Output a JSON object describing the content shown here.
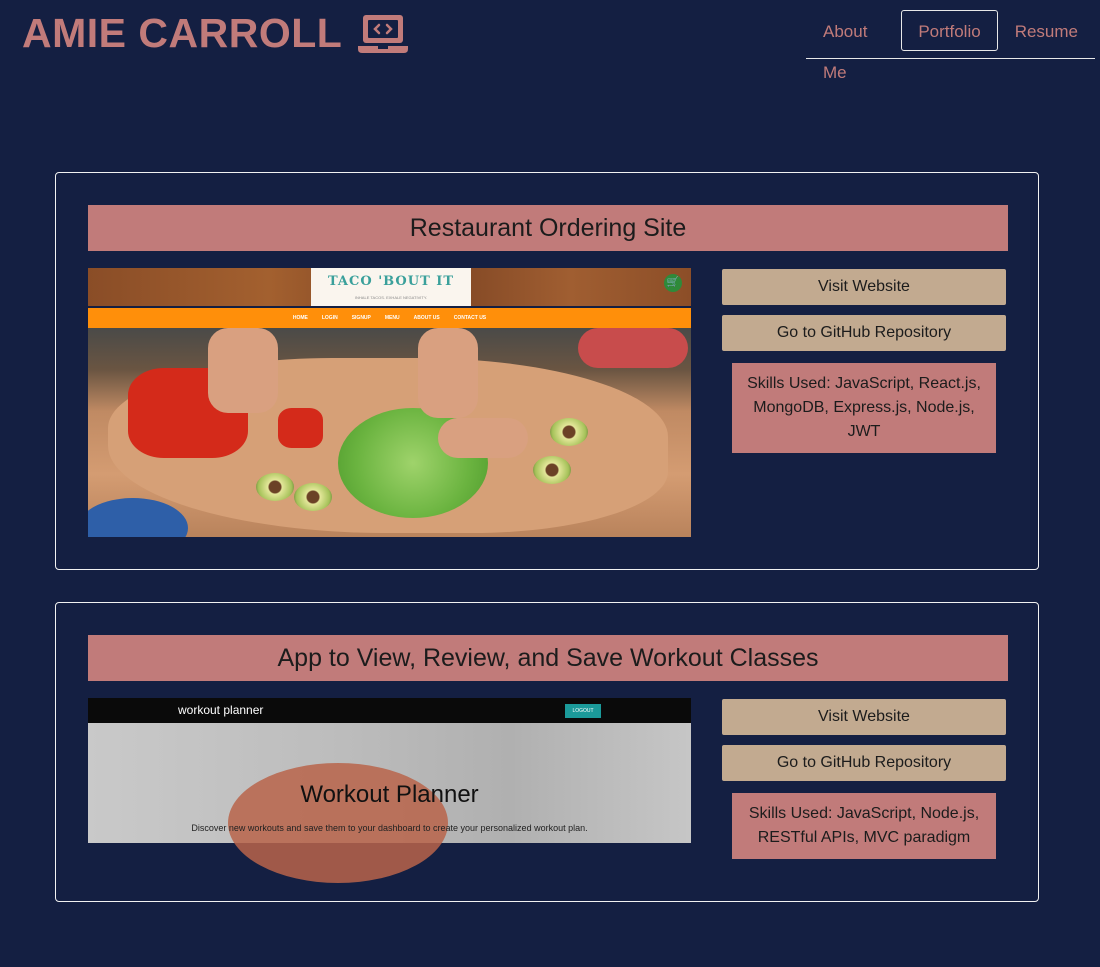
{
  "header": {
    "brand": "AMIE CARROLL",
    "brand_icon": "laptop-code-icon",
    "nav": [
      {
        "label": "About Me",
        "active": false
      },
      {
        "label": "Portfolio",
        "active": true
      },
      {
        "label": "Resume",
        "active": false
      }
    ]
  },
  "projects": [
    {
      "title": "Restaurant Ordering Site",
      "visit_label": "Visit Website",
      "github_label": "Go to GitHub Repository",
      "skills": "Skills Used: JavaScript, React.js, MongoDB, Express.js, Node.js, JWT",
      "screenshot": {
        "logo_title": "TACO 'BOUT IT",
        "logo_sub": "INHALE TACOS. EXHALE NEGATIVITY.",
        "nav": [
          "HOME",
          "LOGIN",
          "SIGNUP",
          "MENU",
          "ABOUT US",
          "CONTACT US"
        ]
      }
    },
    {
      "title": "App to View, Review, and Save Workout Classes",
      "visit_label": "Visit Website",
      "github_label": "Go to GitHub Repository",
      "skills": "Skills Used: JavaScript, Node.js, RESTful APIs, MVC paradigm",
      "screenshot": {
        "logo": "workout planner",
        "logout": "LOGOUT",
        "heading": "Workout Planner",
        "subheading": "Discover new workouts and save them to your dashboard to create your personalized workout plan."
      }
    }
  ],
  "colors": {
    "background": "#141f42",
    "accent_rose": "#c17b7a",
    "button_tan": "#c2aa90"
  }
}
